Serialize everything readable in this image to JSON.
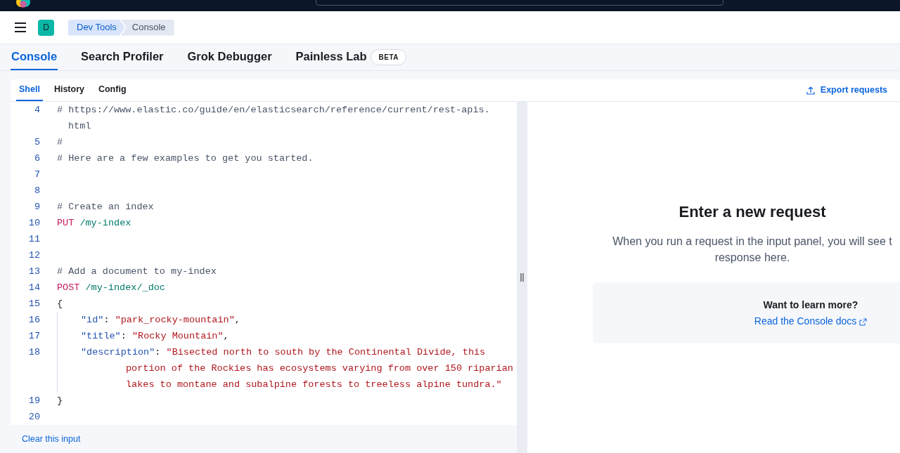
{
  "header": {
    "avatar": "D",
    "breadcrumbs": [
      {
        "label": "Dev Tools",
        "selected": false
      },
      {
        "label": "Console",
        "selected": true
      }
    ]
  },
  "tabs": [
    {
      "label": "Console",
      "selected": true
    },
    {
      "label": "Search Profiler",
      "selected": false
    },
    {
      "label": "Grok Debugger",
      "selected": false
    },
    {
      "label": "Painless Lab",
      "selected": false,
      "badge": "BETA"
    }
  ],
  "sub_tabs": [
    {
      "label": "Shell",
      "selected": true
    },
    {
      "label": "History",
      "selected": false
    },
    {
      "label": "Config",
      "selected": false
    }
  ],
  "export_button": "Export requests",
  "editor": {
    "lines": [
      {
        "number": "4",
        "indented": false,
        "rows": [
          [
            {
              "kind": "comment",
              "text": "# https://www.elastic.co/guide/en/elasticsearch/reference/current/rest-apis."
            }
          ],
          [
            {
              "kind": "comment",
              "text": "html"
            }
          ]
        ]
      },
      {
        "number": "5",
        "indented": false,
        "rows": [
          [
            {
              "kind": "comment",
              "text": "#"
            }
          ]
        ]
      },
      {
        "number": "6",
        "indented": false,
        "rows": [
          [
            {
              "kind": "comment",
              "text": "# Here are a few examples to get you started."
            }
          ]
        ]
      },
      {
        "number": "7",
        "indented": false,
        "rows": [
          []
        ]
      },
      {
        "number": "8",
        "indented": false,
        "rows": [
          []
        ]
      },
      {
        "number": "9",
        "indented": false,
        "rows": [
          [
            {
              "kind": "comment",
              "text": "# Create an index"
            }
          ]
        ]
      },
      {
        "number": "10",
        "indented": false,
        "rows": [
          [
            {
              "kind": "method",
              "text": "PUT"
            },
            {
              "kind": "path",
              "text": "/my-index"
            }
          ]
        ]
      },
      {
        "number": "11",
        "indented": false,
        "rows": [
          []
        ]
      },
      {
        "number": "12",
        "indented": false,
        "rows": [
          []
        ]
      },
      {
        "number": "13",
        "indented": false,
        "rows": [
          [
            {
              "kind": "comment",
              "text": "# Add a document to my-index"
            }
          ]
        ]
      },
      {
        "number": "14",
        "indented": false,
        "rows": [
          [
            {
              "kind": "method",
              "text": "POST"
            },
            {
              "kind": "path",
              "text": "/my-index/_doc"
            }
          ]
        ]
      },
      {
        "number": "15",
        "indented": false,
        "rows": [
          [
            {
              "kind": "punct",
              "text": "{"
            }
          ]
        ]
      },
      {
        "number": "16",
        "indented": true,
        "rows": [
          [
            {
              "kind": "key",
              "text": "\"id\""
            },
            {
              "kind": "punct",
              "text": ":"
            },
            {
              "kind": "string",
              "text": "\"park_rocky-mountain\""
            },
            {
              "kind": "punct",
              "text": ","
            }
          ]
        ]
      },
      {
        "number": "17",
        "indented": true,
        "rows": [
          [
            {
              "kind": "key",
              "text": "\"title\""
            },
            {
              "kind": "punct",
              "text": ":"
            },
            {
              "kind": "string",
              "text": "\"Rocky Mountain\""
            },
            {
              "kind": "punct",
              "text": ","
            }
          ]
        ]
      },
      {
        "number": "18",
        "indented": true,
        "rows": [
          [
            {
              "kind": "key",
              "text": "\"description\""
            },
            {
              "kind": "punct",
              "text": ":"
            },
            {
              "kind": "string",
              "text": "\"Bisected north to south by the Continental Divide, this"
            }
          ],
          [
            {
              "kind": "string",
              "text": "portion of the Rockies has ecosystems varying from over 150 riparian"
            }
          ],
          [
            {
              "kind": "string",
              "text": "lakes to montane and subalpine forests to treeless alpine tundra.\""
            }
          ]
        ]
      },
      {
        "number": "19",
        "indented": false,
        "rows": [
          [
            {
              "kind": "punct",
              "text": "}"
            }
          ]
        ]
      },
      {
        "number": "20",
        "indented": false,
        "rows": [
          []
        ]
      }
    ]
  },
  "clear_button": "Clear this input",
  "output": {
    "title": "Enter a new request",
    "body_lines": [
      "When you run a request in the input panel, you will see t",
      "response here."
    ],
    "learn_more": {
      "title": "Want to learn more?",
      "link": "Read the Console docs"
    }
  }
}
